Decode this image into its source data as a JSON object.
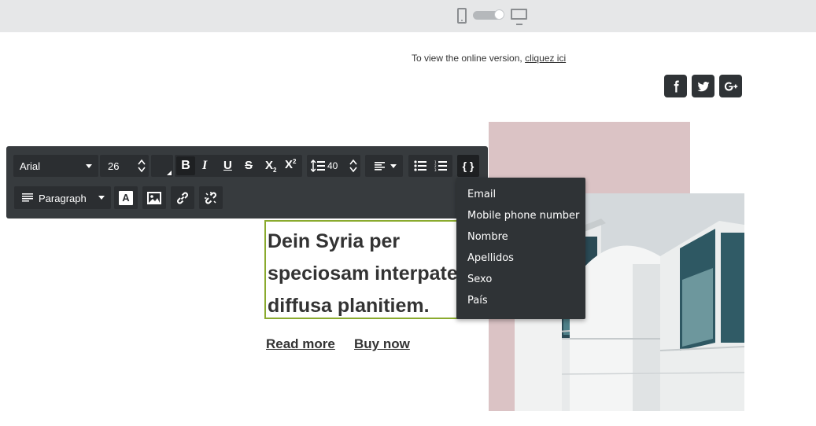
{
  "topbar": {
    "mode_toggle": "desktop"
  },
  "header": {
    "online_prefix": "To view the online version,",
    "online_link": "cliquez ici"
  },
  "social": [
    {
      "name": "facebook-icon",
      "glyph": "f"
    },
    {
      "name": "twitter-icon",
      "glyph": "t"
    },
    {
      "name": "google-plus-icon",
      "glyph": "G+"
    }
  ],
  "toolbar": {
    "font_family": "Arial",
    "font_size": "26",
    "line_height": "40",
    "block_format": "Paragraph",
    "merge_tags_label": "{ }"
  },
  "merge_tags": [
    "Email",
    "Mobile phone number",
    "Nombre",
    "Apellidos",
    "Sexo",
    "País"
  ],
  "content": {
    "heading_lines": [
      "Dein Syria per",
      "speciosam interpatet",
      "diffusa planitiem."
    ],
    "read_more": "Read more",
    "buy_now": "Buy now"
  },
  "colors": {
    "accent_border": "#8aaa2e",
    "toolbar_bg": "#373b3e",
    "pink_block": "#dbc3c5"
  }
}
